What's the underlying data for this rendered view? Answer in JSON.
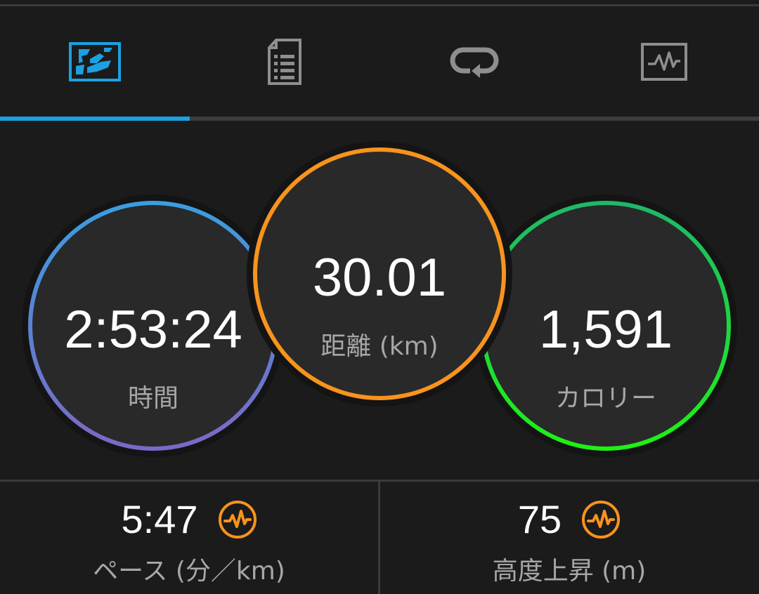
{
  "tabs": [
    {
      "id": "map",
      "icon": "map-icon",
      "selected": true
    },
    {
      "id": "details",
      "icon": "document-list-icon",
      "selected": false
    },
    {
      "id": "laps",
      "icon": "loop-icon",
      "selected": false
    },
    {
      "id": "charts",
      "icon": "chart-pulse-icon",
      "selected": false
    }
  ],
  "circles": {
    "time": {
      "value": "2:53:24",
      "label": "時間",
      "color_top": "#3a9ee0",
      "color_bottom": "#7d67c6"
    },
    "distance": {
      "value": "30.01",
      "label": "距離 (km)",
      "color": "#f7931e"
    },
    "calories": {
      "value": "1,591",
      "label": "カロリー",
      "color_top": "#1eb86a",
      "color_bottom": "#1ef214"
    }
  },
  "stats": {
    "pace": {
      "value": "5:47",
      "label": "ペース (分／km)",
      "icon": "pulse-chart-icon"
    },
    "elevation": {
      "value": "75",
      "label": "高度上昇 (m)",
      "icon": "pulse-chart-icon"
    }
  },
  "colors": {
    "accent": "#1ba1e2",
    "icon_gray": "#8e8e8e",
    "stat_icon": "#f7931e"
  }
}
